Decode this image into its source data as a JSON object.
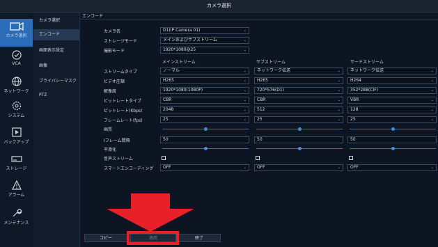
{
  "window": {
    "title": "カメラ選択"
  },
  "left_nav": [
    {
      "label": "カメラ選択",
      "icon": "camera-icon",
      "active": true
    },
    {
      "label": "VCA",
      "icon": "vca-icon",
      "active": false
    },
    {
      "label": "ネットワーク",
      "icon": "globe-icon",
      "active": false
    },
    {
      "label": "システム",
      "icon": "gear-icon",
      "active": false
    },
    {
      "label": "バックアップ",
      "icon": "backup-icon",
      "active": false
    },
    {
      "label": "ストレージ",
      "icon": "storage-icon",
      "active": false
    },
    {
      "label": "アラーム",
      "icon": "alarm-icon",
      "active": false
    },
    {
      "label": "メンテナンス",
      "icon": "wrench-icon",
      "active": false
    }
  ],
  "sub_nav": [
    {
      "label": "カメラ選択",
      "active": false
    },
    {
      "label": "エンコード",
      "active": true
    },
    {
      "label": "画面表示設定",
      "active": false
    },
    {
      "label": "画像",
      "active": false
    },
    {
      "label": "プライバシーマスク",
      "active": false
    },
    {
      "label": "PTZ",
      "active": false
    }
  ],
  "main": {
    "tab": "エンコード",
    "camera_label": "カメラ名",
    "camera_value": "D1(IP Camera 01)",
    "storage_mode_label": "ストレージモード",
    "storage_mode_value": "メインおよびサブストリーム",
    "capture_mode_label": "撮影モード",
    "capture_mode_value": "1920*1080@25",
    "columns": [
      "メインストリーム",
      "サブストリーム",
      "サードストリーム"
    ],
    "rows": {
      "stream_type": {
        "label": "ストリームタイプ",
        "values": [
          "ノーマル",
          "ネットワーク伝送",
          "ネットワーク伝送"
        ]
      },
      "video_codec": {
        "label": "ビデオ圧縮",
        "values": [
          "H265",
          "H265",
          "H264"
        ]
      },
      "resolution": {
        "label": "解像度",
        "values": [
          "1920*1080(1080P)",
          "720*576(D1)",
          "352*288(CIF)"
        ]
      },
      "bitrate_type": {
        "label": "ビットレートタイプ",
        "values": [
          "CBR",
          "CBR",
          "VBR"
        ]
      },
      "bitrate": {
        "label": "ビットレート(Kbps)",
        "values": [
          "2048",
          "512",
          "128"
        ]
      },
      "frame_rate": {
        "label": "フレームレート(fps)",
        "values": [
          "25",
          "25",
          "25"
        ]
      },
      "quality": {
        "label": "画質",
        "levels": [
          0.5,
          0.5,
          0.5
        ]
      },
      "i_frame": {
        "label": "Iフレーム間隔",
        "values": [
          "50",
          "50",
          "50"
        ]
      },
      "smoothing": {
        "label": "平滑化",
        "levels": [
          0.5,
          0.5,
          0.5
        ]
      },
      "audio_stream": {
        "label": "音声ストリーム"
      },
      "smart_encoding": {
        "label": "スマートエンコーディング",
        "values": [
          "OFF",
          "OFF",
          "OFF"
        ]
      }
    }
  },
  "buttons": {
    "copy": "コピー",
    "apply": "適用",
    "exit": "終了"
  },
  "colors": {
    "accent": "#2a6db8",
    "highlight": "#e8202a",
    "background": "#0d1522"
  }
}
